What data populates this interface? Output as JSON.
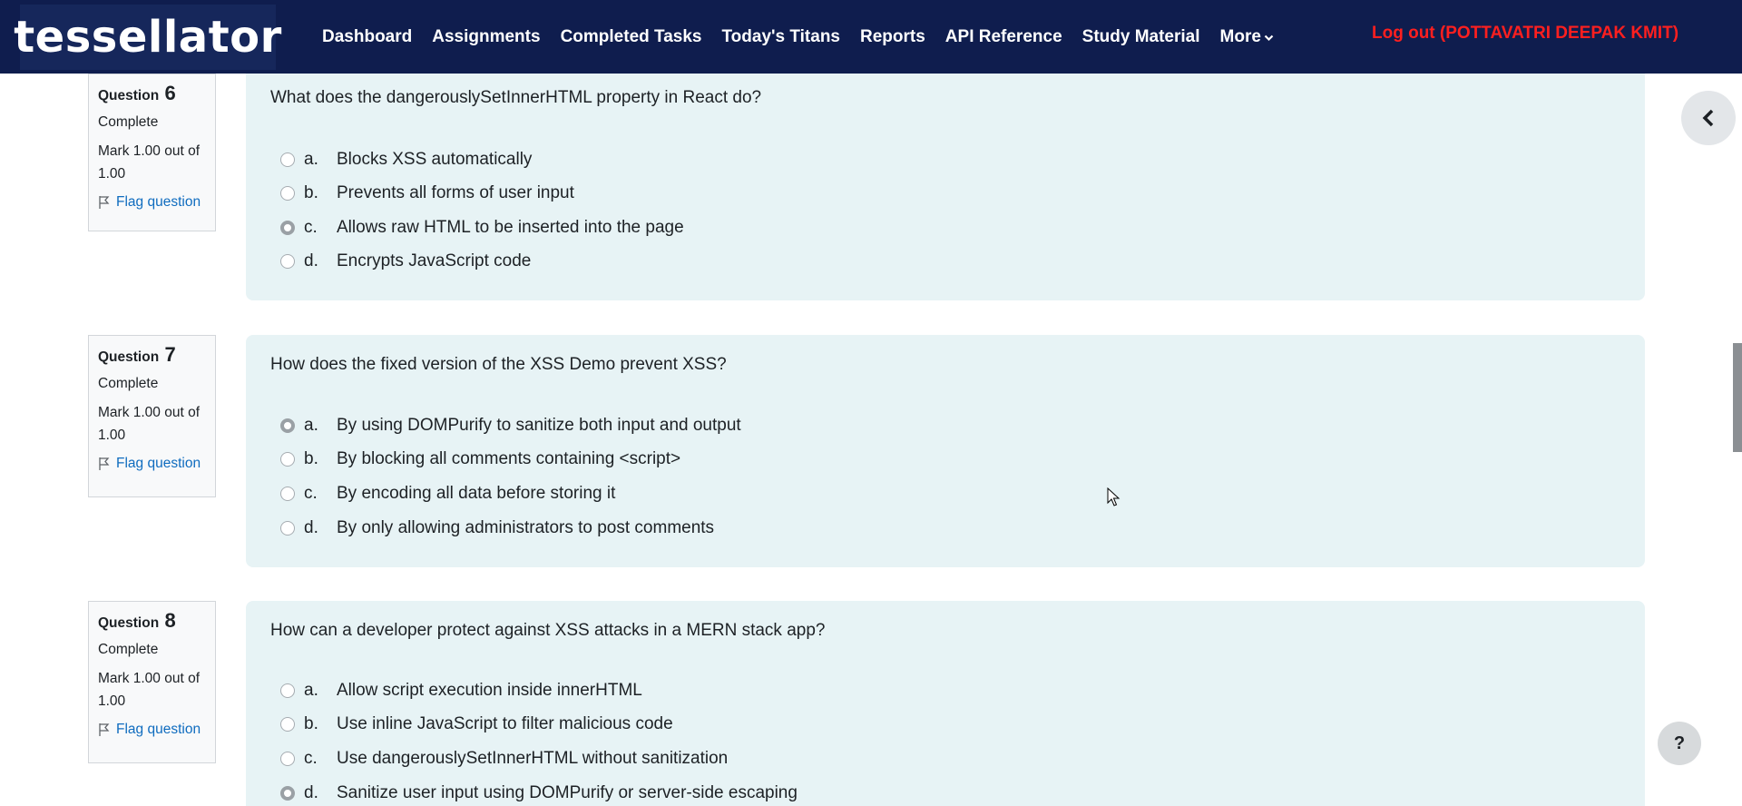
{
  "brand": {
    "logo_text": "tessellator"
  },
  "nav": {
    "items": [
      "Dashboard",
      "Assignments",
      "Completed Tasks",
      "Today's Titans",
      "Reports",
      "API Reference",
      "Study Material",
      "More"
    ],
    "logout": "Log out (POTTAVATRI DEEPAK KMIT)"
  },
  "questions": [
    {
      "title": "Question",
      "number": "6",
      "state": "Complete",
      "grade": "Mark 1.00 out of 1.00",
      "flag": "Flag question",
      "text": "What does the dangerouslySetInnerHTML property in React do?",
      "options": [
        {
          "letter": "a.",
          "text": "Blocks XSS automatically",
          "selected": false
        },
        {
          "letter": "b.",
          "text": "Prevents all forms of user input",
          "selected": false
        },
        {
          "letter": "c.",
          "text": "Allows raw HTML to be inserted into the page",
          "selected": true
        },
        {
          "letter": "d.",
          "text": "Encrypts JavaScript code",
          "selected": false
        }
      ]
    },
    {
      "title": "Question",
      "number": "7",
      "state": "Complete",
      "grade": "Mark 1.00 out of 1.00",
      "flag": "Flag question",
      "text": "How does the fixed version of the XSS Demo prevent XSS?",
      "options": [
        {
          "letter": "a.",
          "text": "By using DOMPurify to sanitize both input and output",
          "selected": true
        },
        {
          "letter": "b.",
          "text": "By blocking all comments containing <script>",
          "selected": false
        },
        {
          "letter": "c.",
          "text": "By encoding all data before storing it",
          "selected": false
        },
        {
          "letter": "d.",
          "text": "By only allowing administrators to post comments",
          "selected": false
        }
      ]
    },
    {
      "title": "Question",
      "number": "8",
      "state": "Complete",
      "grade": "Mark 1.00 out of 1.00",
      "flag": "Flag question",
      "text": "How can a developer protect against XSS attacks in a MERN stack app?",
      "options": [
        {
          "letter": "a.",
          "text": "Allow script execution inside innerHTML",
          "selected": false
        },
        {
          "letter": "b.",
          "text": "Use inline JavaScript to filter malicious code",
          "selected": false
        },
        {
          "letter": "c.",
          "text": "Use dangerouslySetInnerHTML without sanitization",
          "selected": false
        },
        {
          "letter": "d.",
          "text": "Sanitize user input using DOMPurify or server-side escaping",
          "selected": true
        }
      ]
    }
  ],
  "help": {
    "label": "?"
  },
  "icons": {
    "drawer": "chevron-left-icon",
    "flag": "flag-icon",
    "more": "chevron-down-icon"
  }
}
